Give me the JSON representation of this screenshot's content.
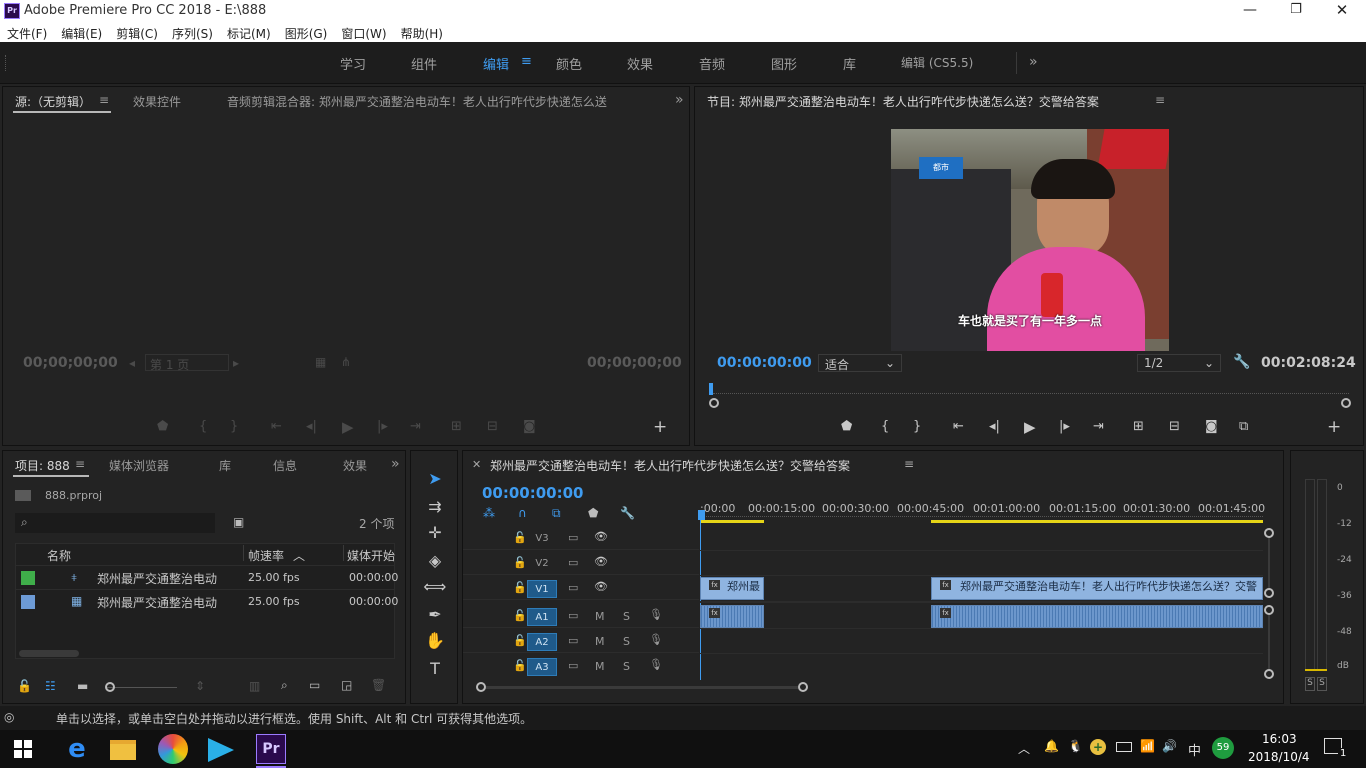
{
  "window": {
    "title": "Adobe Premiere Pro CC 2018 - E:\\888",
    "app_badge": "Pr"
  },
  "menu": [
    "文件(F)",
    "编辑(E)",
    "剪辑(C)",
    "序列(S)",
    "标记(M)",
    "图形(G)",
    "窗口(W)",
    "帮助(H)"
  ],
  "workspaces": [
    "学习",
    "组件",
    "编辑",
    "颜色",
    "效果",
    "音频",
    "图形",
    "库",
    "编辑 (CS5.5)"
  ],
  "workspace_active": "编辑",
  "source_panel": {
    "tabs": [
      "源:（无剪辑）",
      "效果控件",
      "音频剪辑混合器: 郑州最严交通整治电动车！老人出行咋代步快递怎么送"
    ],
    "tc_left": "00;00;00;00",
    "tc_right": "00;00;00;00",
    "page": "第 1 页"
  },
  "program_panel": {
    "title": "节目: 郑州最严交通整治电动车！老人出行咋代步快递怎么送？交警给答案",
    "tc_current": "00:00:00:00",
    "fit": "适合",
    "resolution": "1/2",
    "tc_duration": "00:02:08:24",
    "subtitle": "车也就是买了有一年多一点"
  },
  "project_panel": {
    "tabs": [
      "项目: 888",
      "媒体浏览器",
      "库",
      "信息",
      "效果"
    ],
    "file": "888.prproj",
    "count": "2 个项",
    "columns": [
      "名称",
      "帧速率",
      "媒体开始"
    ],
    "rows": [
      {
        "name": "郑州最严交通整治电动",
        "fps": "25.00 fps",
        "start": "00:00:00",
        "color": "#3fae4a"
      },
      {
        "name": "郑州最严交通整治电动",
        "fps": "25.00 fps",
        "start": "00:00:00",
        "color": "#6d9bd6"
      }
    ]
  },
  "timeline": {
    "title": "郑州最严交通整治电动车！老人出行咋代步快递怎么送？交警给答案",
    "tc": "00:00:00:00",
    "ruler": [
      ":00:00",
      "00:00:15:00",
      "00:00:30:00",
      "00:00:45:00",
      "00:01:00:00",
      "00:01:15:00",
      "00:01:30:00",
      "00:01:45:00"
    ],
    "tracks": [
      "V3",
      "V2",
      "V1",
      "A1",
      "A2",
      "A3"
    ],
    "clip_v1_a": "郑州最",
    "clip_v1_b": "郑州最严交通整治电动车！老人出行咋代步快递怎么送？交警"
  },
  "meter": {
    "scale": [
      "0",
      "-12",
      "-24",
      "-36",
      "-48",
      "dB"
    ],
    "solo": [
      "S",
      "S"
    ]
  },
  "status": "单击以选择，或单击空白处并拖动以进行框选。使用 Shift、Alt 和 Ctrl 可获得其他选项。",
  "taskbar": {
    "time": "16:03",
    "date": "2018/10/4",
    "lang": "中",
    "battery": "59",
    "notif": "1"
  }
}
